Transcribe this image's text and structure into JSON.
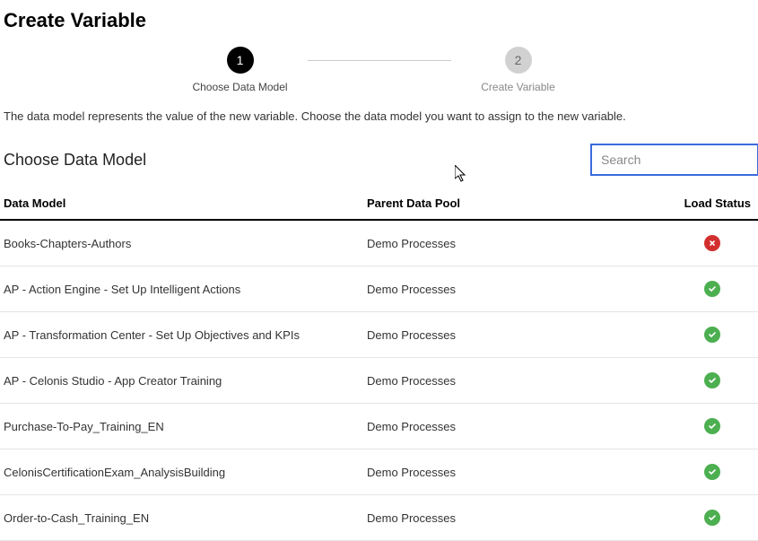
{
  "pageTitle": "Create Variable",
  "stepper": {
    "steps": [
      {
        "number": "1",
        "label": "Choose Data Model",
        "active": true
      },
      {
        "number": "2",
        "label": "Create Variable",
        "active": false
      }
    ]
  },
  "description": "The data model represents the value of the new variable. Choose the data model you want to assign to the new variable.",
  "sectionTitle": "Choose Data Model",
  "search": {
    "placeholder": "Search",
    "value": ""
  },
  "table": {
    "columns": {
      "model": "Data Model",
      "pool": "Parent Data Pool",
      "status": "Load Status"
    },
    "rows": [
      {
        "model": "Books-Chapters-Authors",
        "pool": "Demo Processes",
        "status": "error"
      },
      {
        "model": "AP - Action Engine - Set Up Intelligent Actions",
        "pool": "Demo Processes",
        "status": "success"
      },
      {
        "model": "AP - Transformation Center - Set Up Objectives and KPIs",
        "pool": "Demo Processes",
        "status": "success"
      },
      {
        "model": "AP - Celonis Studio - App Creator Training",
        "pool": "Demo Processes",
        "status": "success"
      },
      {
        "model": "Purchase-To-Pay_Training_EN",
        "pool": "Demo Processes",
        "status": "success"
      },
      {
        "model": "CelonisCertificationExam_AnalysisBuilding",
        "pool": "Demo Processes",
        "status": "success"
      },
      {
        "model": "Order-to-Cash_Training_EN",
        "pool": "Demo Processes",
        "status": "success"
      }
    ]
  }
}
